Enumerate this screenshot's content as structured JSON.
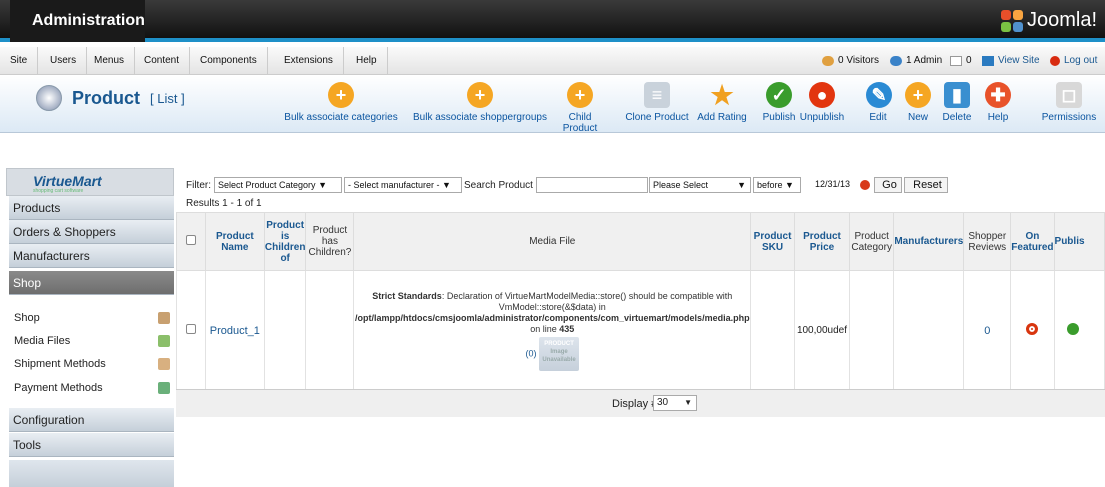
{
  "header": {
    "title": "Administration",
    "logo_text": "Joomla!"
  },
  "menu": {
    "items": [
      "Site",
      "Users",
      "Menus",
      "Content",
      "Components",
      "Extensions",
      "Help"
    ]
  },
  "status": {
    "visitors": "0 Visitors",
    "admin": "1 Admin",
    "messages": "0",
    "view_site": "View Site",
    "logout": "Log out"
  },
  "page": {
    "title": "Product",
    "subtitle": "[ List ]"
  },
  "toolbar": [
    {
      "label": "Bulk associate categories",
      "icon": "plus-icon",
      "color": "#f5a623"
    },
    {
      "label": "Bulk associate shoppergroups",
      "icon": "plus-icon",
      "color": "#f5a623"
    },
    {
      "label": "Child Product",
      "icon": "plus-icon",
      "color": "#f5a623"
    },
    {
      "label": "Clone Product",
      "icon": "copy-icon",
      "color": "#c9d2db"
    },
    {
      "label": "Add Rating",
      "icon": "star-icon",
      "color": "#f0a020"
    },
    {
      "label": "Publish",
      "icon": "check-icon",
      "color": "#3a9c2c"
    },
    {
      "label": "Unpublish",
      "icon": "circle-icon",
      "color": "#e2350f"
    },
    {
      "label": "Edit",
      "icon": "pencil-icon",
      "color": "#2a8ad4"
    },
    {
      "label": "New",
      "icon": "plus-icon",
      "color": "#f5a623"
    },
    {
      "label": "Delete",
      "icon": "trash-icon",
      "color": "#3a8fd0"
    },
    {
      "label": "Help",
      "icon": "lifebuoy-icon",
      "color": "#e8522a"
    },
    {
      "label": "Permissions",
      "icon": "lock-icon",
      "color": "#d8d8d8"
    }
  ],
  "sidebar": {
    "logo": "VirtueMart",
    "logo_sub": "shopping cart software",
    "sections": [
      "Products",
      "Orders & Shoppers",
      "Manufacturers",
      "Shop"
    ],
    "shop_items": [
      "Shop",
      "Media Files",
      "Shipment Methods",
      "Payment Methods"
    ],
    "bottom": [
      "Configuration",
      "Tools"
    ]
  },
  "filter": {
    "label": "Filter:",
    "category": "Select Product Category",
    "manufacturer": "- Select manufacturer -",
    "search_label": "Search Product",
    "search_value": "",
    "please_select": "Please Select",
    "before": "before",
    "date": "12/31/13",
    "go": "Go",
    "reset": "Reset"
  },
  "results": "Results 1 - 1 of 1",
  "table": {
    "headers": [
      "Product Name",
      "Product is Children of",
      "Product has Children?",
      "Media File",
      "Product SKU",
      "Product Price",
      "Product Category",
      "Manufacturers",
      "Shopper Reviews",
      "On Featured",
      "Publis"
    ],
    "row": {
      "name": "Product_1",
      "media_warning_bold": "Strict Standards",
      "media_warning_text": ": Declaration of VirtueMartModelMedia::store() should be compatible with VmModel::store(&$data) in",
      "media_path": "/opt/lampp/htdocs/cmsjoomla/administrator/components/com_virtuemart/models/media.php",
      "media_line_prefix": "on line",
      "media_line": "435",
      "media_count": "(0)",
      "img_text_1": "PRODUCT",
      "img_text_2": "Image Unavailable",
      "price": "100,00udef",
      "reviews": "0"
    }
  },
  "footer": {
    "display_label": "Display #",
    "display_value": "30"
  }
}
